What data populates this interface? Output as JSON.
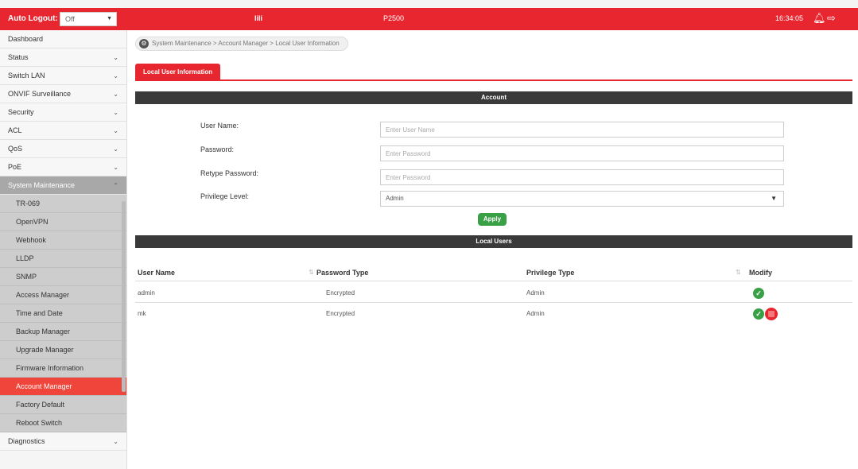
{
  "header": {
    "auto_logout_label": "Auto Logout:",
    "auto_logout_value": "Off",
    "logo_text": "lili",
    "model": "P2500",
    "time": "16:34:05"
  },
  "sidebar": {
    "items": [
      {
        "label": "Dashboard"
      },
      {
        "label": "Status"
      },
      {
        "label": "Switch LAN"
      },
      {
        "label": "ONVIF Surveillance"
      },
      {
        "label": "Security"
      },
      {
        "label": "ACL"
      },
      {
        "label": "QoS"
      },
      {
        "label": "PoE"
      },
      {
        "label": "System Maintenance"
      }
    ],
    "sub_items": [
      {
        "label": "TR-069"
      },
      {
        "label": "OpenVPN"
      },
      {
        "label": "Webhook"
      },
      {
        "label": "LLDP"
      },
      {
        "label": "SNMP"
      },
      {
        "label": "Access Manager"
      },
      {
        "label": "Time and Date"
      },
      {
        "label": "Backup Manager"
      },
      {
        "label": "Upgrade Manager"
      },
      {
        "label": "Firmware Information"
      },
      {
        "label": "Account Manager"
      },
      {
        "label": "Factory Default"
      },
      {
        "label": "Reboot Switch"
      }
    ],
    "last_item": {
      "label": "Diagnostics"
    }
  },
  "breadcrumb": "System Maintenance > Account Manager > Local User Information",
  "tab": "Local User Information",
  "account": {
    "header": "Account",
    "user_name_label": "User Name:",
    "user_name_placeholder": "Enter User Name",
    "password_label": "Password:",
    "password_placeholder": "Enter Password",
    "retype_label": "Retype Password:",
    "retype_placeholder": "Enter Password",
    "privilege_label": "Privilege Level:",
    "privilege_value": "Admin",
    "apply": "Apply"
  },
  "local_users": {
    "header": "Local Users",
    "columns": [
      "User Name",
      "Password Type",
      "Privilege Type",
      "Modify"
    ],
    "rows": [
      {
        "user": "admin",
        "password_type": "Encrypted",
        "privilege": "Admin"
      },
      {
        "user": "mk",
        "password_type": "Encrypted",
        "privilege": "Admin"
      }
    ]
  },
  "colors": {
    "brand_red": "#e8262f",
    "ok_green": "#3aa045"
  },
  "icons": [
    "gear-icon",
    "bell-icon",
    "logout-icon",
    "chevron-down-icon",
    "check-icon",
    "delete-icon"
  ]
}
